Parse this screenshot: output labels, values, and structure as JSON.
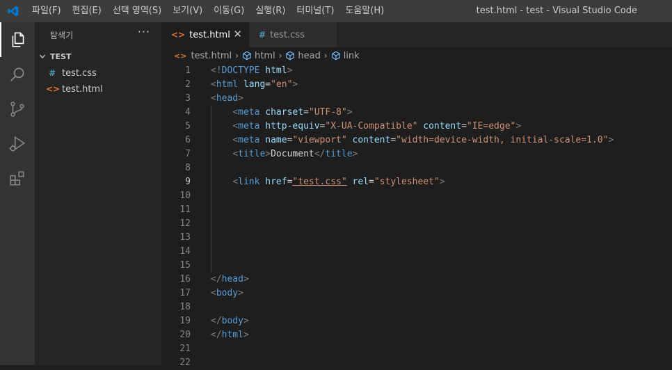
{
  "window_title": "test.html - test - Visual Studio Code",
  "menu": [
    "파일(F)",
    "편집(E)",
    "선택 영역(S)",
    "보기(V)",
    "이동(G)",
    "실행(R)",
    "터미널(T)",
    "도움말(H)"
  ],
  "activity_icons": [
    "explorer-icon",
    "search-icon",
    "source-control-icon",
    "run-debug-icon",
    "extensions-icon"
  ],
  "sidebar": {
    "title": "탐색기",
    "more": "···",
    "folder": "TEST",
    "files": [
      {
        "icon": "#",
        "name": "test.css"
      },
      {
        "icon": "<>",
        "name": "test.html"
      }
    ]
  },
  "tabs": [
    {
      "icon": "<>",
      "label": "test.html",
      "close": "✕"
    },
    {
      "icon": "#",
      "label": "test.css"
    }
  ],
  "breadcrumb": [
    "test.html",
    "html",
    "head",
    "link"
  ],
  "colors": {
    "accent_blue": "#569cd6",
    "attr": "#9cdcfe",
    "string": "#ce9178",
    "html_icon": "#e37933",
    "css_icon": "#519aba",
    "vscode_logo": "#0078d4"
  },
  "current_line": 9,
  "code_lines": [
    {
      "n": "1",
      "tokens": [
        [
          "p",
          "<!"
        ],
        [
          "tag",
          "DOCTYPE"
        ],
        [
          "t",
          " "
        ],
        [
          "attr",
          "html"
        ],
        [
          "p",
          ">"
        ]
      ]
    },
    {
      "n": "2",
      "tokens": [
        [
          "p",
          "<"
        ],
        [
          "tag",
          "html"
        ],
        [
          "t",
          " "
        ],
        [
          "attr",
          "lang"
        ],
        [
          "t",
          "="
        ],
        [
          "str",
          "\"en\""
        ],
        [
          "p",
          ">"
        ]
      ]
    },
    {
      "n": "3",
      "tokens": [
        [
          "p",
          "<"
        ],
        [
          "tag",
          "head"
        ],
        [
          "p",
          ">"
        ]
      ]
    },
    {
      "n": "4",
      "tokens": [
        [
          "t",
          "    "
        ],
        [
          "p",
          "<"
        ],
        [
          "tag",
          "meta"
        ],
        [
          "t",
          " "
        ],
        [
          "attr",
          "charset"
        ],
        [
          "t",
          "="
        ],
        [
          "str",
          "\"UTF-8\""
        ],
        [
          "p",
          ">"
        ]
      ]
    },
    {
      "n": "5",
      "tokens": [
        [
          "t",
          "    "
        ],
        [
          "p",
          "<"
        ],
        [
          "tag",
          "meta"
        ],
        [
          "t",
          " "
        ],
        [
          "attr",
          "http-equiv"
        ],
        [
          "t",
          "="
        ],
        [
          "str",
          "\"X-UA-Compatible\""
        ],
        [
          "t",
          " "
        ],
        [
          "attr",
          "content"
        ],
        [
          "t",
          "="
        ],
        [
          "str",
          "\"IE=edge\""
        ],
        [
          "p",
          ">"
        ]
      ]
    },
    {
      "n": "6",
      "tokens": [
        [
          "t",
          "    "
        ],
        [
          "p",
          "<"
        ],
        [
          "tag",
          "meta"
        ],
        [
          "t",
          " "
        ],
        [
          "attr",
          "name"
        ],
        [
          "t",
          "="
        ],
        [
          "str",
          "\"viewport\""
        ],
        [
          "t",
          " "
        ],
        [
          "attr",
          "content"
        ],
        [
          "t",
          "="
        ],
        [
          "str",
          "\"width=device-width, initial-scale=1.0\""
        ],
        [
          "p",
          ">"
        ]
      ]
    },
    {
      "n": "7",
      "tokens": [
        [
          "t",
          "    "
        ],
        [
          "p",
          "<"
        ],
        [
          "tag",
          "title"
        ],
        [
          "p",
          ">"
        ],
        [
          "t",
          "Document"
        ],
        [
          "p",
          "</"
        ],
        [
          "tag",
          "title"
        ],
        [
          "p",
          ">"
        ]
      ]
    },
    {
      "n": "8",
      "tokens": []
    },
    {
      "n": "9",
      "tokens": [
        [
          "t",
          "    "
        ],
        [
          "p",
          "<"
        ],
        [
          "tag",
          "link"
        ],
        [
          "t",
          " "
        ],
        [
          "attr",
          "href"
        ],
        [
          "t",
          "="
        ],
        [
          "strlink",
          "\"test.css\""
        ],
        [
          "t",
          " "
        ],
        [
          "attr",
          "rel"
        ],
        [
          "t",
          "="
        ],
        [
          "str",
          "\"stylesheet\""
        ],
        [
          "p",
          ">"
        ]
      ]
    },
    {
      "n": "10",
      "tokens": []
    },
    {
      "n": "11",
      "tokens": []
    },
    {
      "n": "12",
      "tokens": []
    },
    {
      "n": "13",
      "tokens": []
    },
    {
      "n": "14",
      "tokens": []
    },
    {
      "n": "15",
      "tokens": []
    },
    {
      "n": "16",
      "tokens": [
        [
          "p",
          "</"
        ],
        [
          "tag",
          "head"
        ],
        [
          "p",
          ">"
        ]
      ]
    },
    {
      "n": "17",
      "tokens": [
        [
          "p",
          "<"
        ],
        [
          "tag",
          "body"
        ],
        [
          "p",
          ">"
        ]
      ]
    },
    {
      "n": "18",
      "tokens": []
    },
    {
      "n": "19",
      "tokens": [
        [
          "p",
          "</"
        ],
        [
          "tag",
          "body"
        ],
        [
          "p",
          ">"
        ]
      ]
    },
    {
      "n": "20",
      "tokens": [
        [
          "p",
          "</"
        ],
        [
          "tag",
          "html"
        ],
        [
          "p",
          ">"
        ]
      ]
    },
    {
      "n": "21",
      "tokens": []
    },
    {
      "n": "22",
      "tokens": []
    }
  ]
}
